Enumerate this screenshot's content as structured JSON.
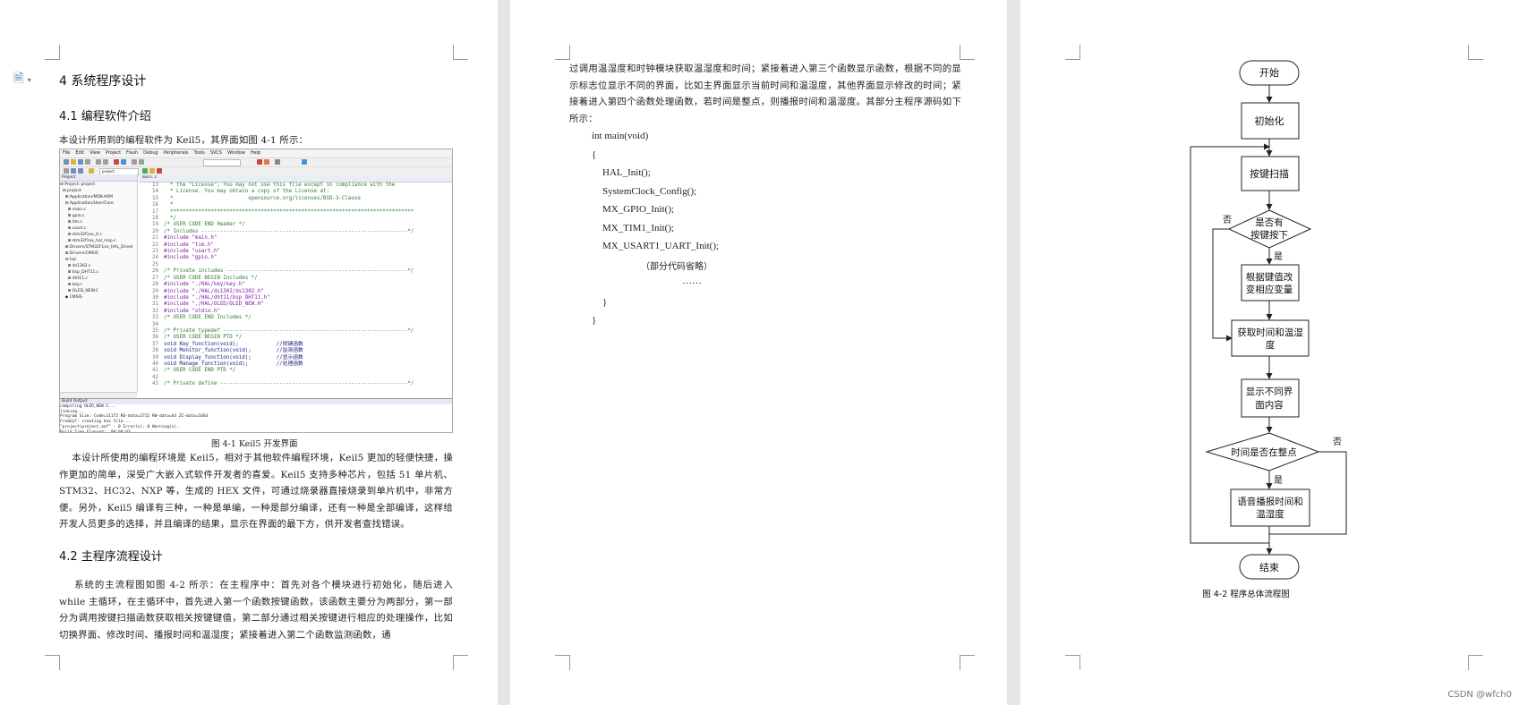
{
  "page1": {
    "heading1": "4 系统程序设计",
    "section1": {
      "title": "4.1 编程软件介绍",
      "intro": "本设计所用到的编程软件为 Keil5，其界面如图 4-1 所示："
    },
    "keil": {
      "menu": [
        "File",
        "Edit",
        "View",
        "Project",
        "Flash",
        "Debug",
        "Peripherals",
        "Tools",
        "SVCS",
        "Window",
        "Help"
      ],
      "target": "project",
      "project_header": "Project",
      "project_items": [
        "⊟ Project: project",
        "  ⊟ project",
        "    ⊞ Application/MDK-ARM",
        "    ⊟ Application/User/Core",
        "      ⊞ main.c",
        "      ⊞ gpio.c",
        "      ⊞ tim.c",
        "      ⊞ usart.c",
        "      ⊞ stm32f1xx_it.c",
        "      ⊞ stm32f1xx_hal_msp.c",
        "    ⊞ Drivers/STM32F1xx_HAL_Driver",
        "    ⊞ Drivers/CMSIS",
        "    ⊟ hal",
        "      ⊞ ds1302.c",
        "      ⊞ bsp_DHT11.c",
        "      ⊞ dht11.c",
        "      ⊞ key.c",
        "      ⊞ OLED_NEW.C",
        "    ◆ CMSIS"
      ],
      "file_tab": "main.c",
      "code_lines": [
        {
          "n": "13",
          "t": "  * the \"License\"; You may not use this file except in compliance with the",
          "c": "#2e7d32"
        },
        {
          "n": "14",
          "t": "  * License. You may obtain a copy of the License at:",
          "c": "#2e7d32"
        },
        {
          "n": "15",
          "t": "  *                        opensource.org/licenses/BSD-3-Clause",
          "c": "#2e7d32"
        },
        {
          "n": "16",
          "t": "  *",
          "c": "#2e7d32"
        },
        {
          "n": "17",
          "t": "  ******************************************************************************",
          "c": "#2e7d32"
        },
        {
          "n": "18",
          "t": "  */",
          "c": "#2e7d32"
        },
        {
          "n": "19",
          "t": "/* USER CODE END Header */",
          "c": "#2e7d32"
        },
        {
          "n": "20",
          "t": "/* Includes ------------------------------------------------------------------*/",
          "c": "#2e7d32"
        },
        {
          "n": "21",
          "t": "#include \"main.h\"",
          "c": "#7b1fa2"
        },
        {
          "n": "22",
          "t": "#include \"tim.h\"",
          "c": "#7b1fa2"
        },
        {
          "n": "23",
          "t": "#include \"usart.h\"",
          "c": "#7b1fa2"
        },
        {
          "n": "24",
          "t": "#include \"gpio.h\"",
          "c": "#7b1fa2"
        },
        {
          "n": "25",
          "t": "",
          "c": "#222"
        },
        {
          "n": "26",
          "t": "/* Private includes ----------------------------------------------------------*/",
          "c": "#2e7d32"
        },
        {
          "n": "27",
          "t": "/* USER CODE BEGIN Includes */",
          "c": "#2e7d32"
        },
        {
          "n": "28",
          "t": "#include \"./HAL/key/key.h\"",
          "c": "#7b1fa2"
        },
        {
          "n": "29",
          "t": "#include \"./HAL/ds1302/ds1302.h\"",
          "c": "#7b1fa2"
        },
        {
          "n": "30",
          "t": "#include \"./HAL/dht11/bsp_DHT11.h\"",
          "c": "#7b1fa2"
        },
        {
          "n": "31",
          "t": "#include \"./HAL/OLED/OLED_NEW.H\"",
          "c": "#7b1fa2"
        },
        {
          "n": "32",
          "t": "#include \"stdio.h\"",
          "c": "#7b1fa2"
        },
        {
          "n": "33",
          "t": "/* USER CODE END Includes */",
          "c": "#2e7d32"
        },
        {
          "n": "34",
          "t": "",
          "c": "#222"
        },
        {
          "n": "35",
          "t": "/* Private typedef -----------------------------------------------------------*/",
          "c": "#2e7d32"
        },
        {
          "n": "36",
          "t": "/* USER CODE BEGIN PTD */",
          "c": "#2e7d32"
        },
        {
          "n": "37",
          "t": "void Key_function(void);            //按键函数",
          "c": "#1a237e"
        },
        {
          "n": "38",
          "t": "void Monitor_function(void);        //监测函数",
          "c": "#1a237e"
        },
        {
          "n": "39",
          "t": "void Display_function(void);        //显示函数",
          "c": "#1a237e"
        },
        {
          "n": "40",
          "t": "void Manage_function(void);         //处理函数",
          "c": "#1a237e"
        },
        {
          "n": "41",
          "t": "/* USER CODE END PTD */",
          "c": "#2e7d32"
        },
        {
          "n": "42",
          "t": "",
          "c": "#222"
        },
        {
          "n": "43",
          "t": "/* Private define ------------------------------------------------------------*/",
          "c": "#2e7d32"
        }
      ],
      "build_header": "Build Output",
      "build_lines": [
        "compiling OLED_NEW.C...",
        "linking...",
        "Program Size: Code=11172 RO-data=2732 RW-data=64 ZI-data=1664",
        "FromELF: creating hex file...",
        "\"project\\project.axf\" - 0 Error(s), 0 Warning(s).",
        "Build Time Elapsed:  00:00:03"
      ]
    },
    "fig1_caption": "图 4-1 Keil5 开发界面",
    "para1": "    本设计所使用的编程环境是 Keil5，相对于其他软件编程环境，Keil5 更加的轻便快捷，操作更加的简单，深受广大嵌入式软件开发者的喜爱。Keil5 支持多种芯片，包括 51 单片机、STM32、HC32、NXP 等，生成的 HEX 文件，可通过烧录器直接烧录到单片机中，非常方便。另外，Keil5 编译有三种，一种是单编，一种是部分编译，还有一种是全部编译，这样给开发人员更多的选择，并且编译的结果，显示在界面的最下方，供开发者查找错误。",
    "section2": {
      "title": "4.2 主程序流程设计"
    },
    "para2": "    系统的主流程图如图 4-2 所示：在主程序中：首先对各个模块进行初始化，随后进入 while 主循环，在主循环中，首先进入第一个函数按键函数，该函数主要分为两部分，第一部分为调用按键扫描函数获取相关按键键值，第二部分通过相关按键进行相应的处理操作，比如切换界面、修改时间、播报时间和温湿度；紧接着进入第二个函数监测函数，通"
  },
  "page2": {
    "para": "过调用温湿度和时钟模块获取温湿度和时间；紧接着进入第三个函数显示函数，根据不同的显示标志位显示不同的界面，比如主界面显示当前时间和温湿度，其他界面显示修改的时间；紧接着进入第四个函数处理函数，若时间是整点，则播报时间和温湿度。其部分主程序源码如下所示：",
    "code": [
      "int main(void)",
      "{",
      "HAL_Init();",
      "SystemClock_Config();",
      "MX_GPIO_Init();",
      "MX_TIM1_Init();",
      "MX_USART1_UART_Init();",
      "（部分代码省略）",
      "……",
      "}",
      "}"
    ]
  },
  "flowchart": {
    "start": "开始",
    "init": "初始化",
    "scan": "按键扫描",
    "decision1": [
      "是否有",
      "按键按下"
    ],
    "modify": [
      "根据键值改",
      "变相应变量"
    ],
    "get": [
      "获取时间和温湿",
      "度"
    ],
    "display": [
      "显示不同界",
      "面内容"
    ],
    "decision2": "时间是否在整点",
    "announce": [
      "语音播报时间和",
      "温湿度"
    ],
    "end": "结束",
    "yes": "是",
    "no": "否",
    "caption": "图 4-2  程序总体流程图"
  },
  "watermark": "CSDN @wfch0"
}
